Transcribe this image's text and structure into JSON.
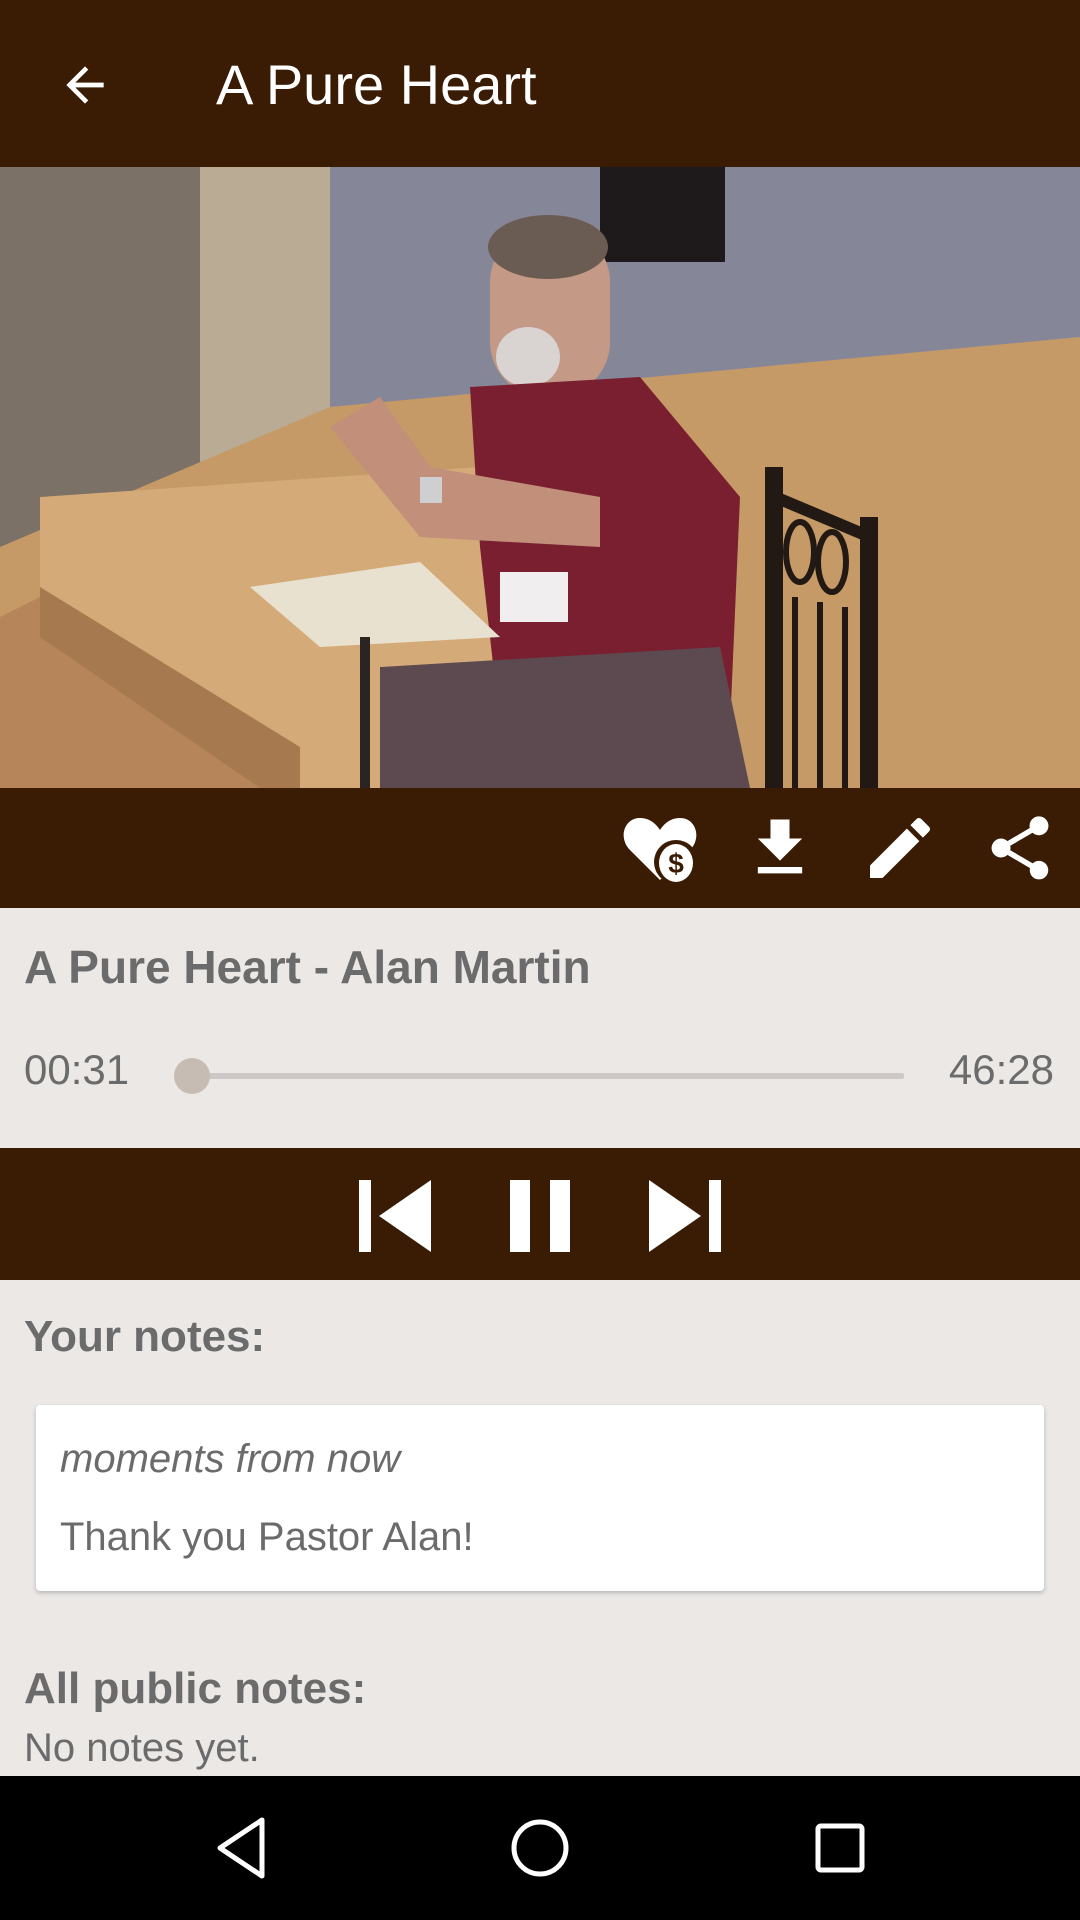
{
  "app_bar": {
    "back_icon": "arrow-left-icon",
    "title": "A Pure Heart"
  },
  "video": {
    "description": "Video frame: speaker in maroon shirt seated on chair beside music stand with open book, wooden stage steps"
  },
  "actions": [
    {
      "name": "donate",
      "icon": "heart-dollar-icon"
    },
    {
      "name": "download",
      "icon": "download-icon"
    },
    {
      "name": "edit-note",
      "icon": "pencil-icon"
    },
    {
      "name": "share",
      "icon": "share-icon"
    }
  ],
  "player": {
    "track_title": "A Pure Heart - Alan Martin",
    "current_time": "00:31",
    "duration": "46:28",
    "progress_fraction": 0.011
  },
  "controls": [
    {
      "name": "previous",
      "icon": "skip-previous-icon"
    },
    {
      "name": "pause",
      "icon": "pause-icon"
    },
    {
      "name": "next",
      "icon": "skip-next-icon"
    }
  ],
  "your_notes": {
    "heading": "Your notes:",
    "items": [
      {
        "timestamp": "moments from now",
        "text": "Thank you Pastor Alan!"
      }
    ]
  },
  "public_notes": {
    "heading": "All public notes:",
    "empty_text": "No notes yet."
  },
  "system_nav": [
    {
      "name": "back",
      "icon": "nav-back-icon"
    },
    {
      "name": "home",
      "icon": "nav-home-icon"
    },
    {
      "name": "recents",
      "icon": "nav-recents-icon"
    }
  ],
  "colors": {
    "bar_brown": "#3a1c05",
    "background": "#ebe8e6",
    "text_gray": "#6b6b6b",
    "seek_thumb": "#c6bcb3"
  }
}
